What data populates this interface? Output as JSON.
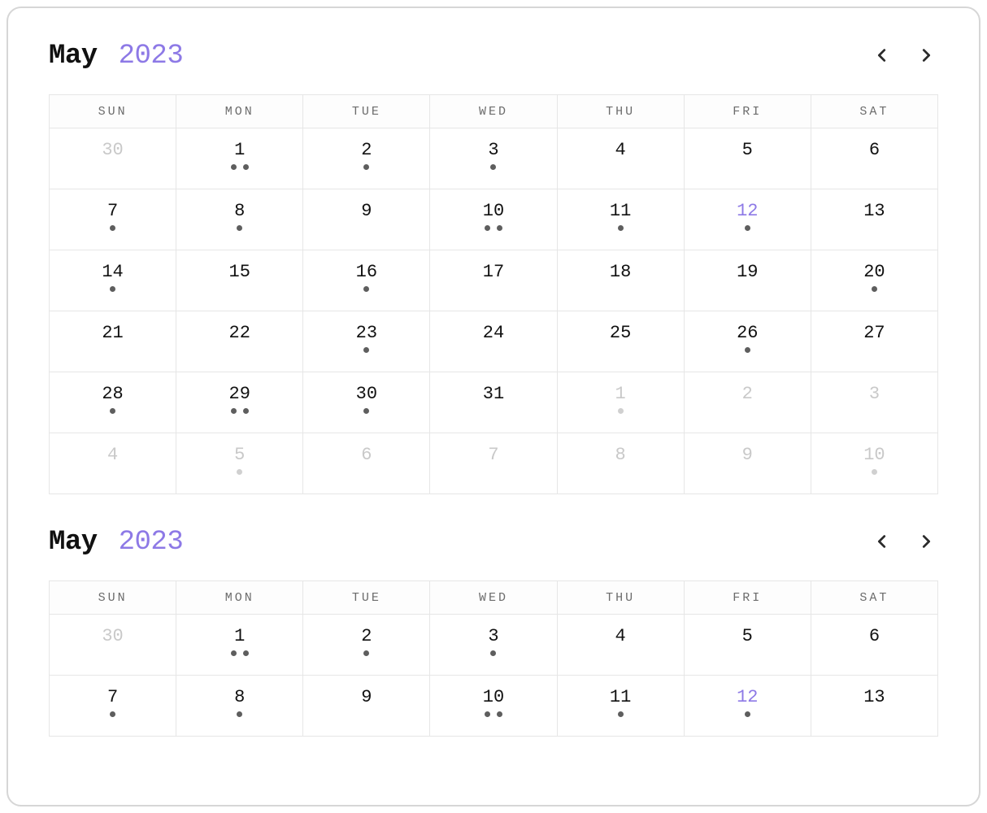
{
  "weekday_labels": [
    "SUN",
    "MON",
    "TUE",
    "WED",
    "THU",
    "FRI",
    "SAT"
  ],
  "calendars": [
    {
      "month": "May",
      "year": "2023",
      "weeks": [
        [
          {
            "n": "30",
            "outside": true,
            "today": false,
            "dots": 0
          },
          {
            "n": "1",
            "outside": false,
            "today": false,
            "dots": 2
          },
          {
            "n": "2",
            "outside": false,
            "today": false,
            "dots": 1
          },
          {
            "n": "3",
            "outside": false,
            "today": false,
            "dots": 1
          },
          {
            "n": "4",
            "outside": false,
            "today": false,
            "dots": 0
          },
          {
            "n": "5",
            "outside": false,
            "today": false,
            "dots": 0
          },
          {
            "n": "6",
            "outside": false,
            "today": false,
            "dots": 0
          }
        ],
        [
          {
            "n": "7",
            "outside": false,
            "today": false,
            "dots": 1
          },
          {
            "n": "8",
            "outside": false,
            "today": false,
            "dots": 1
          },
          {
            "n": "9",
            "outside": false,
            "today": false,
            "dots": 0
          },
          {
            "n": "10",
            "outside": false,
            "today": false,
            "dots": 2
          },
          {
            "n": "11",
            "outside": false,
            "today": false,
            "dots": 1
          },
          {
            "n": "12",
            "outside": false,
            "today": true,
            "dots": 1
          },
          {
            "n": "13",
            "outside": false,
            "today": false,
            "dots": 0
          }
        ],
        [
          {
            "n": "14",
            "outside": false,
            "today": false,
            "dots": 1
          },
          {
            "n": "15",
            "outside": false,
            "today": false,
            "dots": 0
          },
          {
            "n": "16",
            "outside": false,
            "today": false,
            "dots": 1
          },
          {
            "n": "17",
            "outside": false,
            "today": false,
            "dots": 0
          },
          {
            "n": "18",
            "outside": false,
            "today": false,
            "dots": 0
          },
          {
            "n": "19",
            "outside": false,
            "today": false,
            "dots": 0
          },
          {
            "n": "20",
            "outside": false,
            "today": false,
            "dots": 1
          }
        ],
        [
          {
            "n": "21",
            "outside": false,
            "today": false,
            "dots": 0
          },
          {
            "n": "22",
            "outside": false,
            "today": false,
            "dots": 0
          },
          {
            "n": "23",
            "outside": false,
            "today": false,
            "dots": 1
          },
          {
            "n": "24",
            "outside": false,
            "today": false,
            "dots": 0
          },
          {
            "n": "25",
            "outside": false,
            "today": false,
            "dots": 0
          },
          {
            "n": "26",
            "outside": false,
            "today": false,
            "dots": 1
          },
          {
            "n": "27",
            "outside": false,
            "today": false,
            "dots": 0
          }
        ],
        [
          {
            "n": "28",
            "outside": false,
            "today": false,
            "dots": 1
          },
          {
            "n": "29",
            "outside": false,
            "today": false,
            "dots": 2
          },
          {
            "n": "30",
            "outside": false,
            "today": false,
            "dots": 1
          },
          {
            "n": "31",
            "outside": false,
            "today": false,
            "dots": 0
          },
          {
            "n": "1",
            "outside": true,
            "today": false,
            "dots": 1
          },
          {
            "n": "2",
            "outside": true,
            "today": false,
            "dots": 0
          },
          {
            "n": "3",
            "outside": true,
            "today": false,
            "dots": 0
          }
        ],
        [
          {
            "n": "4",
            "outside": true,
            "today": false,
            "dots": 0
          },
          {
            "n": "5",
            "outside": true,
            "today": false,
            "dots": 1
          },
          {
            "n": "6",
            "outside": true,
            "today": false,
            "dots": 0
          },
          {
            "n": "7",
            "outside": true,
            "today": false,
            "dots": 0
          },
          {
            "n": "8",
            "outside": true,
            "today": false,
            "dots": 0
          },
          {
            "n": "9",
            "outside": true,
            "today": false,
            "dots": 0
          },
          {
            "n": "10",
            "outside": true,
            "today": false,
            "dots": 1
          }
        ]
      ]
    },
    {
      "month": "May",
      "year": "2023",
      "weeks": [
        [
          {
            "n": "30",
            "outside": true,
            "today": false,
            "dots": 0
          },
          {
            "n": "1",
            "outside": false,
            "today": false,
            "dots": 2
          },
          {
            "n": "2",
            "outside": false,
            "today": false,
            "dots": 1
          },
          {
            "n": "3",
            "outside": false,
            "today": false,
            "dots": 1
          },
          {
            "n": "4",
            "outside": false,
            "today": false,
            "dots": 0
          },
          {
            "n": "5",
            "outside": false,
            "today": false,
            "dots": 0
          },
          {
            "n": "6",
            "outside": false,
            "today": false,
            "dots": 0
          }
        ],
        [
          {
            "n": "7",
            "outside": false,
            "today": false,
            "dots": 1
          },
          {
            "n": "8",
            "outside": false,
            "today": false,
            "dots": 1
          },
          {
            "n": "9",
            "outside": false,
            "today": false,
            "dots": 0
          },
          {
            "n": "10",
            "outside": false,
            "today": false,
            "dots": 2
          },
          {
            "n": "11",
            "outside": false,
            "today": false,
            "dots": 1
          },
          {
            "n": "12",
            "outside": false,
            "today": true,
            "dots": 1
          },
          {
            "n": "13",
            "outside": false,
            "today": false,
            "dots": 0
          }
        ]
      ]
    }
  ]
}
